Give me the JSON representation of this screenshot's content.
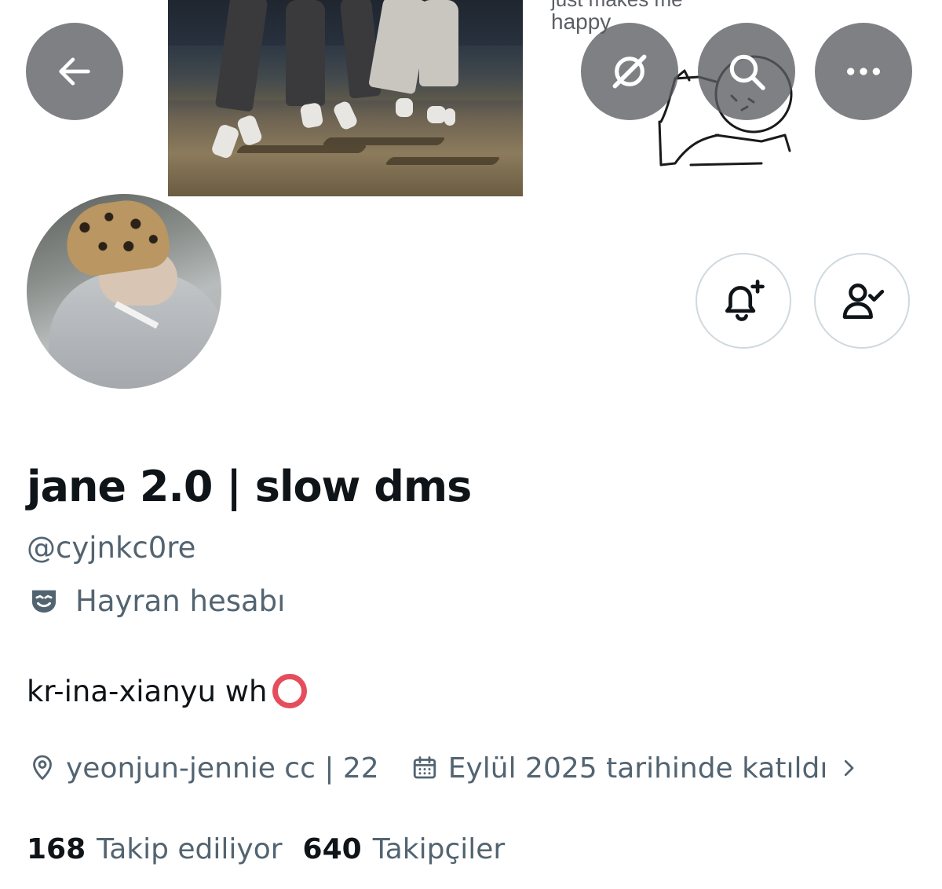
{
  "banner": {
    "caption_partial": "just makes me",
    "caption": "happy"
  },
  "top_bar": {
    "back_icon": "arrow-left-icon",
    "grok_icon": "grok-icon",
    "search_icon": "search-icon",
    "more_icon": "more-horizontal-icon"
  },
  "actions": {
    "notify_icon": "bell-plus-icon",
    "following_icon": "user-check-icon"
  },
  "profile": {
    "display_name": "jane 2.0 | slow dms",
    "handle": "@cyjnkc0re",
    "category_icon": "theater-mask-icon",
    "category": "Hayran hesabı",
    "bio": "kr-ina-xianyu wh",
    "bio_emoji": "hollow-red-circle",
    "location": "yeonjun-jennie cc | 22",
    "joined": "Eylül 2025 tarihinde katıldı"
  },
  "stats": {
    "following_count": "168",
    "following_label": "Takip ediliyor",
    "followers_count": "640",
    "followers_label": "Takipçiler"
  },
  "colors": {
    "primary_text": "#0f1419",
    "secondary_text": "#536471",
    "overlay_button": "#5a5c60",
    "outline": "#cfd9de",
    "emoji_red": "#e64d5c"
  }
}
